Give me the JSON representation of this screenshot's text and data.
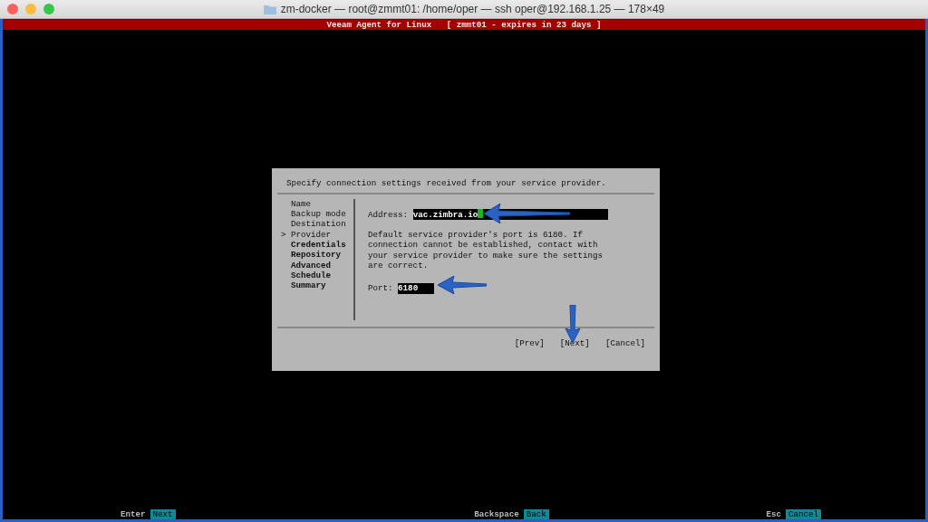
{
  "window": {
    "title": "zm-docker — root@zmmt01: /home/oper — ssh oper@192.168.1.25 — 178×49"
  },
  "header": {
    "title": "Veeam Agent for Linux   [ zmmt01 - expires in 23 days ]"
  },
  "dialog": {
    "instruction": "Specify connection settings received from your service provider.",
    "current_marker": ">",
    "steps": [
      {
        "label": "Name",
        "selected": false,
        "completed": true
      },
      {
        "label": "Backup mode",
        "selected": false,
        "completed": true
      },
      {
        "label": "Destination",
        "selected": false,
        "completed": true
      },
      {
        "label": "Provider",
        "selected": true,
        "completed": true
      },
      {
        "label": "Credentials",
        "selected": false,
        "completed": false
      },
      {
        "label": "Repository",
        "selected": false,
        "completed": false
      },
      {
        "label": "Advanced",
        "selected": false,
        "completed": false
      },
      {
        "label": "Schedule",
        "selected": false,
        "completed": false
      },
      {
        "label": "Summary",
        "selected": false,
        "completed": false
      }
    ],
    "address": {
      "label": "Address:",
      "value": "vac.zimbra.io"
    },
    "note": "Default service provider's port is 6180. If connection cannot be established, contact with your service provider to make sure the settings are correct.",
    "port": {
      "label": "Port:",
      "value": "6180"
    },
    "buttons": [
      "[Prev]",
      "[Next]",
      "[Cancel]"
    ]
  },
  "footer": [
    {
      "key": "Enter",
      "action": "Next"
    },
    {
      "key": "Backspace",
      "action": "Back"
    },
    {
      "key": "Esc",
      "action": "Cancel"
    }
  ]
}
